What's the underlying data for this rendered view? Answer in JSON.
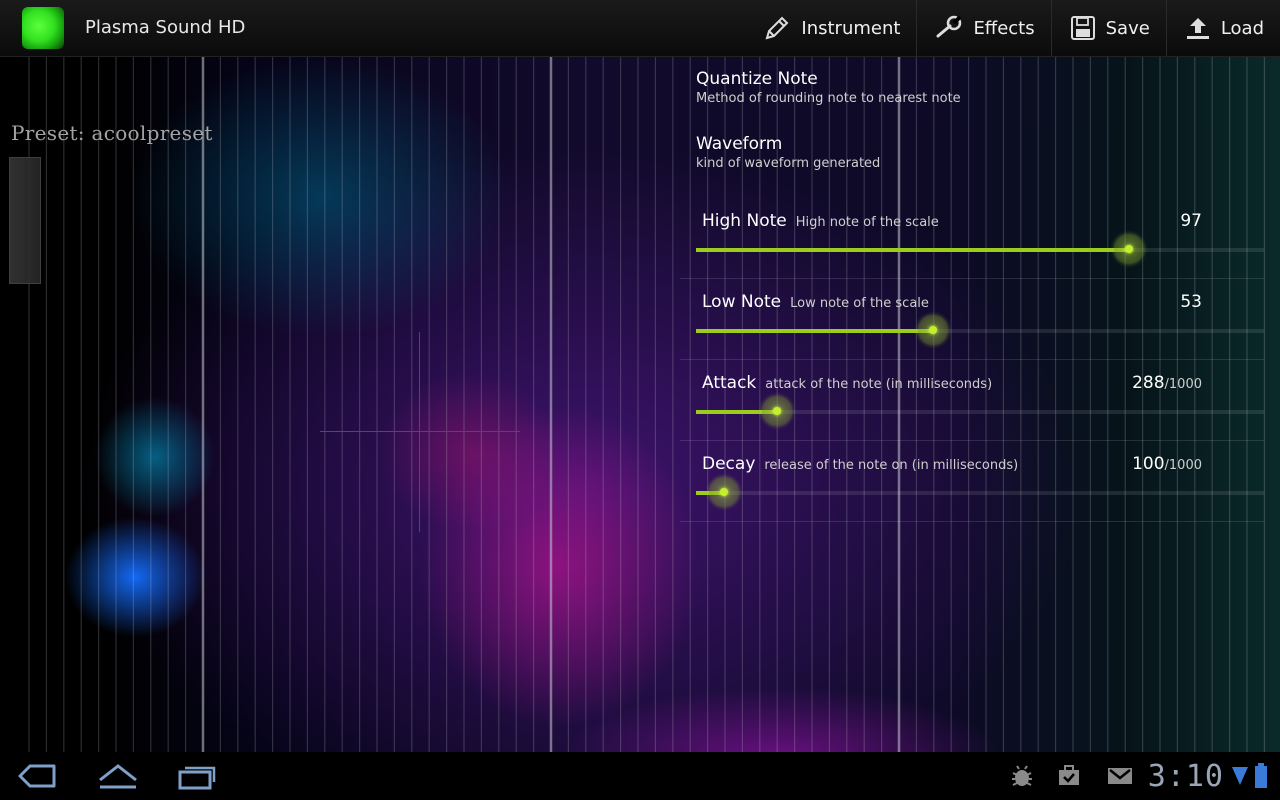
{
  "app": {
    "title": "Plasma Sound HD"
  },
  "actionbar": {
    "actions": [
      {
        "label": "Instrument",
        "icon": "pencil-icon"
      },
      {
        "label": "Effects",
        "icon": "wrench-icon"
      },
      {
        "label": "Save",
        "icon": "floppy-disk-icon"
      },
      {
        "label": "Load",
        "icon": "upload-icon"
      }
    ]
  },
  "stage": {
    "preset_label": "Preset: acoolpreset"
  },
  "settings": {
    "quantize": {
      "title": "Quantize Note",
      "summary": "Method of rounding note to nearest note"
    },
    "waveform": {
      "title": "Waveform",
      "summary": "kind of waveform generated"
    },
    "sliders": [
      {
        "title": "High Note",
        "desc": "High note of the scale",
        "value": "97",
        "max": "",
        "fraction": 0.762
      },
      {
        "title": "Low Note",
        "desc": "Low note of the scale",
        "value": "53",
        "max": "",
        "fraction": 0.417
      },
      {
        "title": "Attack",
        "desc": "attack of the note (in milliseconds)",
        "value": "288",
        "max": "/1000",
        "fraction": 0.143
      },
      {
        "title": "Decay",
        "desc": "release of the note on (in milliseconds)",
        "value": "100",
        "max": "/1000",
        "fraction": 0.049
      }
    ]
  },
  "systembar": {
    "clock": "3:10",
    "accent": "#9ccd1c"
  }
}
